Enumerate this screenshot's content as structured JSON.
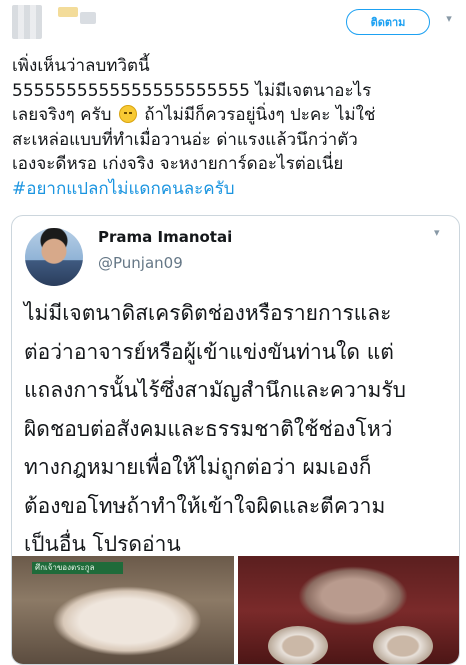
{
  "header": {
    "follow_label": "ติดตาม"
  },
  "tweet": {
    "lines": [
      "เพิ่งเห็นว่าลบทวิตนี้",
      "5555555555555555555555 ไม่มีเจตนาอะไร",
      "เลยจริงๆ ครับ",
      " ถ้าไม่มีก็ควรอยู่นิ่งๆ ปะคะ ไม่ใช่",
      "สะเหล่อแบบที่ทำเมื่อวานอ่ะ ด่าแรงแล้วนึกว่าตัว",
      "เองจะดีหรอ เก่งจริง จะหงายการ์ดอะไรต่อเนี่ย"
    ],
    "hashtag": "#อยากแปลกไม่แดกคนละครับ"
  },
  "quoted": {
    "name": "Prama Imanotai",
    "handle": "@Punjan09",
    "lines": [
      "ไม่มีเจตนาดิสเครดิตช่องหรือรายการและ",
      "ต่อว่าอาจารย์หรือผู้เข้าแข่งขันท่านใด แต่",
      "แถลงการนั้นไร้ซึ่งสามัญสำนึกและความรับ",
      "ผิดชอบต่อสังคมและธรรมชาติใช้ช่องโหว่",
      "ทางกฎหมายเพื่อให้ไม่ถูกต่อว่า ผมเองก็",
      "ต้องขอโทษถ้าทำให้เข้าใจผิดและตีความ",
      "เป็นอื่น โปรดอ่าน"
    ],
    "media_logo_text": "ศึกเจ้าของตระกูล"
  },
  "icons": {
    "chevron": "chevron-down-icon",
    "emoji": "frowning-face-emoji-icon"
  },
  "colors": {
    "accent": "#1da1f2",
    "hashtag": "#1b95e0",
    "secondary_text": "#657786",
    "border": "#ccd6dd"
  }
}
